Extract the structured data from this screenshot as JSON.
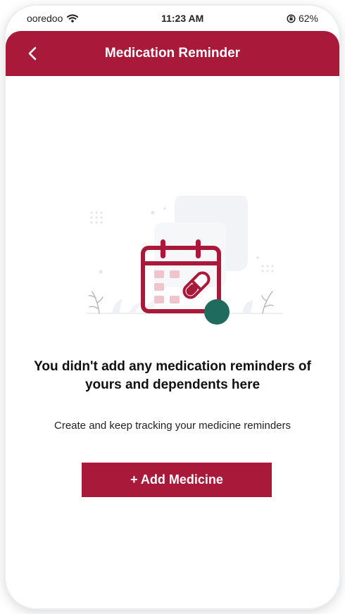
{
  "status_bar": {
    "carrier": "ooredoo",
    "time": "11:23 AM",
    "battery": "62%",
    "icons": [
      "wifi-icon",
      "orientation-lock-icon"
    ]
  },
  "header": {
    "title": "Medication Reminder",
    "back_icon": "chevron-left-icon"
  },
  "empty_state": {
    "illustration": "calendar-pill-icon",
    "title": "You didn't add any medication reminders of yours and dependents here",
    "subtitle": "Create and keep tracking your medicine reminders",
    "button_label": "+ Add Medicine"
  },
  "colors": {
    "brand": "#a8193a",
    "accent": "#1f6b5d"
  }
}
